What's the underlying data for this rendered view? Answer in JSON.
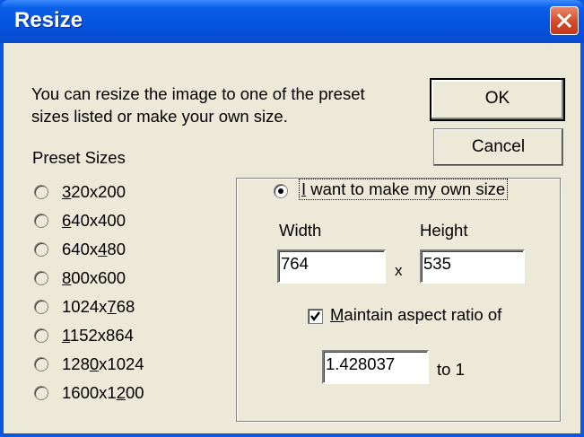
{
  "dialog": {
    "title": "Resize",
    "intro_line1": "You can resize the image to one of the preset",
    "intro_line2": "sizes listed or make your own size.",
    "ok_label": "OK",
    "cancel_label": "Cancel"
  },
  "presets": {
    "label": "Preset Sizes",
    "items": [
      {
        "pre": "",
        "mn": "3",
        "post": "20x200"
      },
      {
        "pre": "",
        "mn": "6",
        "post": "40x400"
      },
      {
        "pre": "640x",
        "mn": "4",
        "post": "80"
      },
      {
        "pre": "",
        "mn": "8",
        "post": "00x600"
      },
      {
        "pre": "1024x",
        "mn": "7",
        "post": "68"
      },
      {
        "pre": "",
        "mn": "1",
        "post": "152x864"
      },
      {
        "pre": "128",
        "mn": "0",
        "post": "x1024"
      },
      {
        "pre": "1600x1",
        "mn": "2",
        "post": "00"
      }
    ]
  },
  "custom": {
    "option_mnemonic": "I",
    "option_rest": " want to make my own size",
    "width_label": "Width",
    "height_label": "Height",
    "width_value": "764",
    "height_value": "535",
    "times": "x",
    "aspect_mnemonic": "M",
    "aspect_rest": "aintain aspect ratio of",
    "aspect_checked": true,
    "aspect_value": "1.428037",
    "to_one": "to 1"
  },
  "colors": {
    "titlebar": "#0552dc",
    "dialog_face": "#ece9d8",
    "close_button": "#d24a2a"
  }
}
